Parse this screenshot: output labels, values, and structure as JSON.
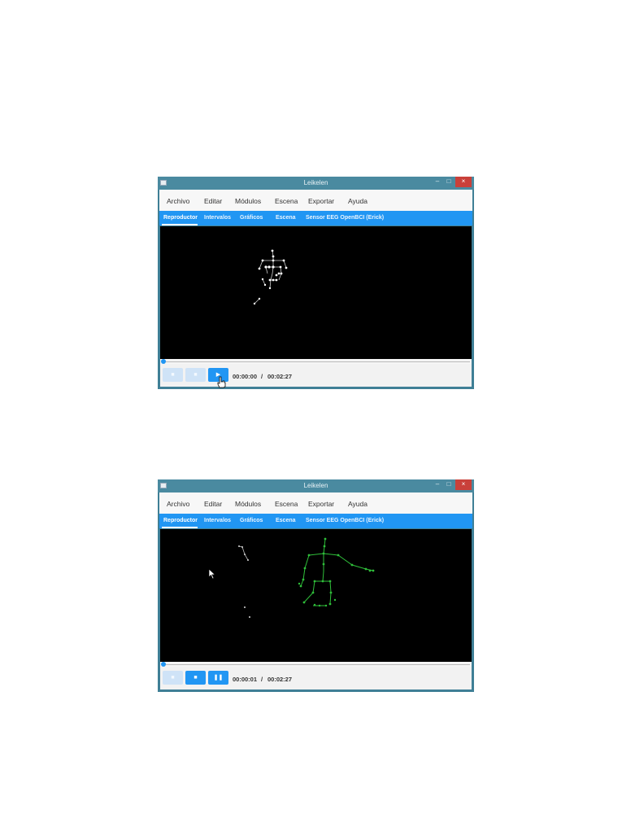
{
  "windows": [
    {
      "title": "Leikelen",
      "window_controls": {
        "minimize": "–",
        "maximize": "□",
        "close": "×"
      },
      "menu": [
        "Archivo",
        "Editar",
        "Módulos",
        "Escena",
        "Exportar",
        "Ayuda"
      ],
      "tabs": [
        "Reproductor",
        "Intervalos",
        "Gráficos",
        "Escena",
        "Sensor EEG OpenBCI (Erick)"
      ],
      "active_tab": "Reproductor",
      "playback": {
        "current_time": "00:00:00",
        "separator": "/",
        "total_time": "00:02:27",
        "progress_fraction": 0.0,
        "buttons": [
          {
            "icon": "■",
            "state": "disabled"
          },
          {
            "icon": "■",
            "state": "disabled"
          },
          {
            "icon": "▶",
            "state": "enabled"
          }
        ]
      },
      "skeleton_color": "#d8d8d8"
    },
    {
      "title": "Leikelen",
      "window_controls": {
        "minimize": "–",
        "maximize": "□",
        "close": "×"
      },
      "menu": [
        "Archivo",
        "Editar",
        "Módulos",
        "Escena",
        "Exportar",
        "Ayuda"
      ],
      "tabs": [
        "Reproductor",
        "Intervalos",
        "Gráficos",
        "Escena",
        "Sensor EEG OpenBCI (Erick)"
      ],
      "active_tab": "Reproductor",
      "playback": {
        "current_time": "00:00:01",
        "separator": "/",
        "total_time": "00:02:27",
        "progress_fraction": 0.0,
        "buttons": [
          {
            "icon": "■",
            "state": "disabled"
          },
          {
            "icon": "■",
            "state": "enabled"
          },
          {
            "icon": "❚❚",
            "state": "enabled"
          }
        ]
      },
      "skeleton_color": "#2fbf3a"
    }
  ],
  "colors": {
    "accent": "#2196f3",
    "titlebar": "#4a8aa0",
    "close": "#c9403a",
    "scene_bg": "#000000"
  }
}
